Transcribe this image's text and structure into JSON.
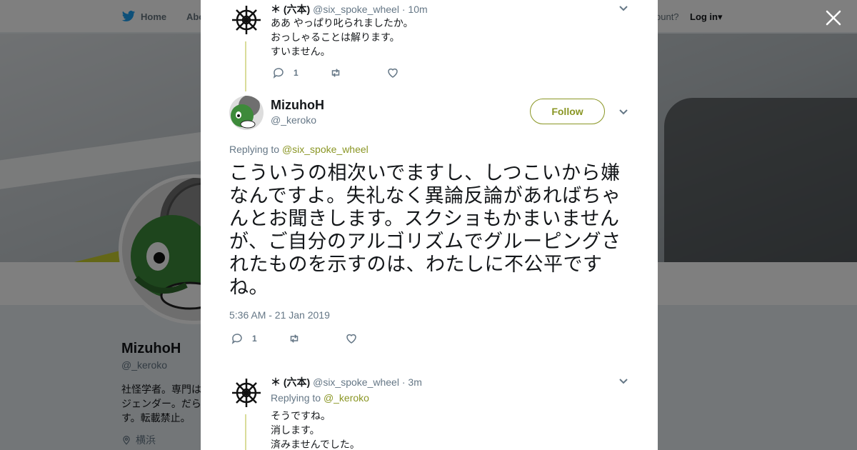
{
  "background_page": {
    "nav": {
      "home_label": "Home",
      "about_label": "Abo",
      "account_prompt": "ccount?",
      "login_label": "Log in"
    },
    "profile": {
      "name": "MizuhoH",
      "handle": "@_keroko",
      "bio_lines": [
        "社怪学者。専門は",
        "ジェンダー。だら",
        "す。転載禁止。"
      ],
      "location": "横浜"
    }
  },
  "modal": {
    "tweets": [
      {
        "display_name": "＊ (六本)",
        "screen_name": "@six_spoke_wheel",
        "separator": "·",
        "time": "10m",
        "text": "ああ やっぱり叱られましたか。\nおっしゃることは解ります。\nすいません。",
        "reply_count": "1"
      },
      {
        "display_name": "MizuhoH",
        "screen_name": "@_keroko",
        "follow_label": "Follow",
        "replying_prefix": "Replying to",
        "replying_to": "@six_spoke_wheel",
        "text": "こういうの相次いでますし、しつこいから嫌なんですよ。失礼なく異論反論があればちゃんとお聞きします。スクショもかまいませんが、ご自分のアルゴリズムでグルーピングされたものを示すのは、わたしに不公平ですね。",
        "timestamp": "5:36 AM - 21 Jan 2019",
        "reply_count": "1"
      },
      {
        "display_name": "＊ (六本)",
        "screen_name": "@six_spoke_wheel",
        "separator": "·",
        "time": "3m",
        "replying_prefix": "Replying to",
        "replying_to": "@_keroko",
        "text": "そうですね。\n消します。\n済みませんでした。"
      }
    ]
  },
  "colors": {
    "accent": "#8a9624",
    "thread_line": "#d9dc9a",
    "muted": "#657786"
  }
}
